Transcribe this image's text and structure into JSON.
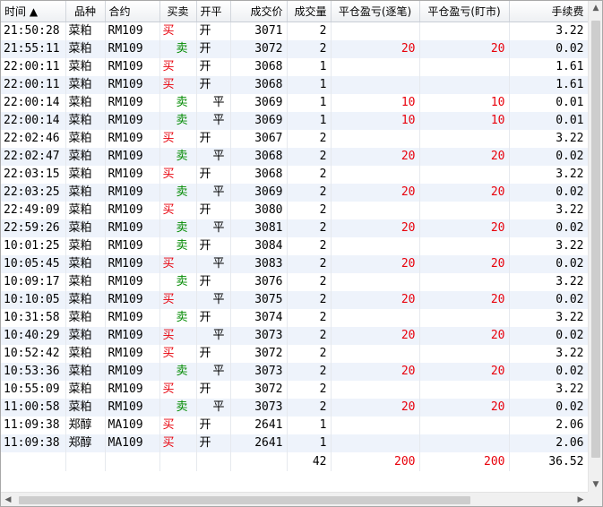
{
  "columns": [
    "时间 ▲",
    "品种",
    "合约",
    "买卖",
    "开平",
    "成交价",
    "成交量",
    "平仓盈亏(逐笔)",
    "平仓盈亏(盯市)",
    "手续费"
  ],
  "rows": [
    {
      "time": "21:50:28",
      "product": "菜粕",
      "contract": "RM109",
      "side": "买",
      "oc": "开",
      "price": "3071",
      "qty": "2",
      "pnl_trade": "",
      "pnl_mark": "",
      "fee": "3.22"
    },
    {
      "time": "21:55:11",
      "product": "菜粕",
      "contract": "RM109",
      "side": "卖",
      "oc": "开",
      "price": "3072",
      "qty": "2",
      "pnl_trade": "20",
      "pnl_mark": "20",
      "fee": "0.02"
    },
    {
      "time": "22:00:11",
      "product": "菜粕",
      "contract": "RM109",
      "side": "买",
      "oc": "开",
      "price": "3068",
      "qty": "1",
      "pnl_trade": "",
      "pnl_mark": "",
      "fee": "1.61"
    },
    {
      "time": "22:00:11",
      "product": "菜粕",
      "contract": "RM109",
      "side": "买",
      "oc": "开",
      "price": "3068",
      "qty": "1",
      "pnl_trade": "",
      "pnl_mark": "",
      "fee": "1.61"
    },
    {
      "time": "22:00:14",
      "product": "菜粕",
      "contract": "RM109",
      "side": "卖",
      "oc": "平",
      "price": "3069",
      "qty": "1",
      "pnl_trade": "10",
      "pnl_mark": "10",
      "fee": "0.01"
    },
    {
      "time": "22:00:14",
      "product": "菜粕",
      "contract": "RM109",
      "side": "卖",
      "oc": "平",
      "price": "3069",
      "qty": "1",
      "pnl_trade": "10",
      "pnl_mark": "10",
      "fee": "0.01"
    },
    {
      "time": "22:02:46",
      "product": "菜粕",
      "contract": "RM109",
      "side": "买",
      "oc": "开",
      "price": "3067",
      "qty": "2",
      "pnl_trade": "",
      "pnl_mark": "",
      "fee": "3.22"
    },
    {
      "time": "22:02:47",
      "product": "菜粕",
      "contract": "RM109",
      "side": "卖",
      "oc": "平",
      "price": "3068",
      "qty": "2",
      "pnl_trade": "20",
      "pnl_mark": "20",
      "fee": "0.02"
    },
    {
      "time": "22:03:15",
      "product": "菜粕",
      "contract": "RM109",
      "side": "买",
      "oc": "开",
      "price": "3068",
      "qty": "2",
      "pnl_trade": "",
      "pnl_mark": "",
      "fee": "3.22"
    },
    {
      "time": "22:03:25",
      "product": "菜粕",
      "contract": "RM109",
      "side": "卖",
      "oc": "平",
      "price": "3069",
      "qty": "2",
      "pnl_trade": "20",
      "pnl_mark": "20",
      "fee": "0.02"
    },
    {
      "time": "22:49:09",
      "product": "菜粕",
      "contract": "RM109",
      "side": "买",
      "oc": "开",
      "price": "3080",
      "qty": "2",
      "pnl_trade": "",
      "pnl_mark": "",
      "fee": "3.22"
    },
    {
      "time": "22:59:26",
      "product": "菜粕",
      "contract": "RM109",
      "side": "卖",
      "oc": "平",
      "price": "3081",
      "qty": "2",
      "pnl_trade": "20",
      "pnl_mark": "20",
      "fee": "0.02"
    },
    {
      "time": "10:01:25",
      "product": "菜粕",
      "contract": "RM109",
      "side": "卖",
      "oc": "开",
      "price": "3084",
      "qty": "2",
      "pnl_trade": "",
      "pnl_mark": "",
      "fee": "3.22"
    },
    {
      "time": "10:05:45",
      "product": "菜粕",
      "contract": "RM109",
      "side": "买",
      "oc": "平",
      "price": "3083",
      "qty": "2",
      "pnl_trade": "20",
      "pnl_mark": "20",
      "fee": "0.02"
    },
    {
      "time": "10:09:17",
      "product": "菜粕",
      "contract": "RM109",
      "side": "卖",
      "oc": "开",
      "price": "3076",
      "qty": "2",
      "pnl_trade": "",
      "pnl_mark": "",
      "fee": "3.22"
    },
    {
      "time": "10:10:05",
      "product": "菜粕",
      "contract": "RM109",
      "side": "买",
      "oc": "平",
      "price": "3075",
      "qty": "2",
      "pnl_trade": "20",
      "pnl_mark": "20",
      "fee": "0.02"
    },
    {
      "time": "10:31:58",
      "product": "菜粕",
      "contract": "RM109",
      "side": "卖",
      "oc": "开",
      "price": "3074",
      "qty": "2",
      "pnl_trade": "",
      "pnl_mark": "",
      "fee": "3.22"
    },
    {
      "time": "10:40:29",
      "product": "菜粕",
      "contract": "RM109",
      "side": "买",
      "oc": "平",
      "price": "3073",
      "qty": "2",
      "pnl_trade": "20",
      "pnl_mark": "20",
      "fee": "0.02"
    },
    {
      "time": "10:52:42",
      "product": "菜粕",
      "contract": "RM109",
      "side": "买",
      "oc": "开",
      "price": "3072",
      "qty": "2",
      "pnl_trade": "",
      "pnl_mark": "",
      "fee": "3.22"
    },
    {
      "time": "10:53:36",
      "product": "菜粕",
      "contract": "RM109",
      "side": "卖",
      "oc": "平",
      "price": "3073",
      "qty": "2",
      "pnl_trade": "20",
      "pnl_mark": "20",
      "fee": "0.02"
    },
    {
      "time": "10:55:09",
      "product": "菜粕",
      "contract": "RM109",
      "side": "买",
      "oc": "开",
      "price": "3072",
      "qty": "2",
      "pnl_trade": "",
      "pnl_mark": "",
      "fee": "3.22"
    },
    {
      "time": "11:00:58",
      "product": "菜粕",
      "contract": "RM109",
      "side": "卖",
      "oc": "平",
      "price": "3073",
      "qty": "2",
      "pnl_trade": "20",
      "pnl_mark": "20",
      "fee": "0.02"
    },
    {
      "time": "11:09:38",
      "product": "郑醇",
      "contract": "MA109",
      "side": "买",
      "oc": "开",
      "price": "2641",
      "qty": "1",
      "pnl_trade": "",
      "pnl_mark": "",
      "fee": "2.06"
    },
    {
      "time": "11:09:38",
      "product": "郑醇",
      "contract": "MA109",
      "side": "买",
      "oc": "开",
      "price": "2641",
      "qty": "1",
      "pnl_trade": "",
      "pnl_mark": "",
      "fee": "2.06"
    }
  ],
  "totals": {
    "qty": "42",
    "pnl_trade": "200",
    "pnl_mark": "200",
    "fee": "36.52"
  },
  "icons": {
    "sort": "sort-ascending-icon",
    "scroll_up": "scroll-up-arrow-icon",
    "scroll_down": "scroll-down-arrow-icon",
    "scroll_left": "scroll-left-arrow-icon",
    "scroll_right": "scroll-right-arrow-icon"
  },
  "colors": {
    "buy": "#e8000b",
    "sell": "#008a00",
    "pnl": "#e8000b",
    "stripe": "#eef3fb"
  }
}
